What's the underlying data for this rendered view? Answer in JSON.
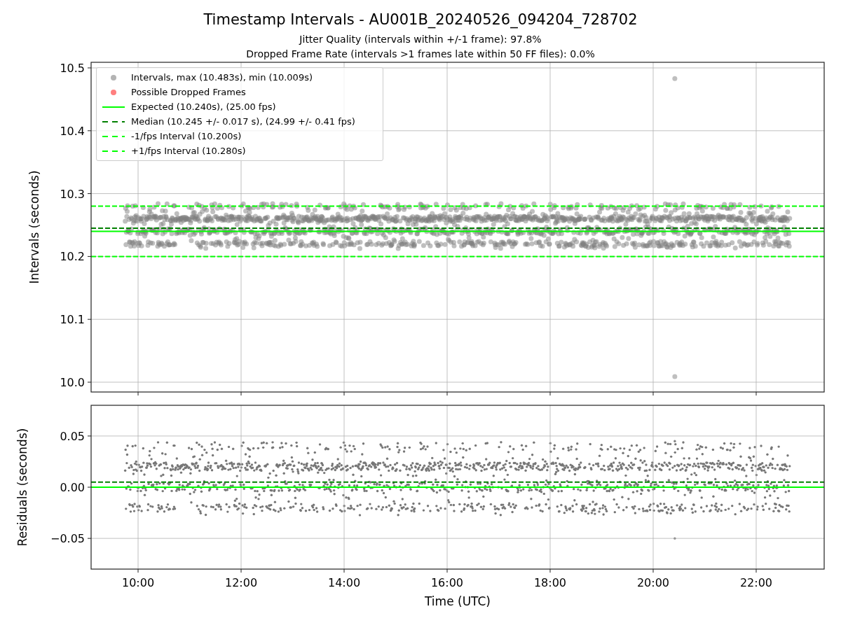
{
  "title": "Timestamp Intervals - AU001B_20240526_094204_728702",
  "subtitles": [
    "Jitter Quality (intervals within +/-1 frame): 97.8%",
    "Dropped Frame Rate (intervals >1 frames late within 50 FF files): 0.0%"
  ],
  "legend": [
    {
      "label": "Intervals, max (10.483s), min (10.009s)",
      "color": "#b3b3b3"
    },
    {
      "label": "Possible Dropped Frames",
      "color": "#ff7f7f"
    }
  ],
  "intervals_chart": {
    "chart_data": {
      "type": "line",
      "ylabel": "Intervals (seconds)",
      "grid": true,
      "x": [
        9.088,
        23.32
      ],
      "xlim": [
        9.088,
        23.32
      ],
      "ylim": [
        9.9844,
        10.5089
      ],
      "yticks": [
        {
          "value": 10.0,
          "label": "10.0"
        },
        {
          "value": 10.1,
          "label": "10.1"
        },
        {
          "value": 10.2,
          "label": "10.2"
        },
        {
          "value": 10.3,
          "label": "10.3"
        },
        {
          "value": 10.4,
          "label": "10.4"
        },
        {
          "value": 10.5,
          "label": "10.5"
        }
      ],
      "series": [
        {
          "name": "Expected (10.240s), (25.00 fps)",
          "color": "#00ff00",
          "line_style": "solid",
          "values": [
            10.24,
            10.24
          ]
        },
        {
          "name": "Median (10.245 +/- 0.017 s), (24.99 +/- 0.41 fps)",
          "color": "#008000",
          "line_style": "dashed",
          "values": [
            10.245,
            10.245
          ]
        },
        {
          "name": "-1/fps Interval (10.200s)",
          "color": "#00ff00",
          "line_style": "dashed",
          "values": [
            10.2,
            10.2
          ]
        },
        {
          "name": "+1/fps Interval (10.280s)",
          "color": "#00ff00",
          "line_style": "dashed",
          "values": [
            10.28,
            10.28
          ]
        }
      ]
    }
  },
  "residuals_chart": {
    "chart_data": {
      "type": "line",
      "xlabel": "Time (UTC)",
      "ylabel": "Residuals (seconds)",
      "grid": true,
      "x": [
        9.088,
        23.32
      ],
      "xlim": [
        9.088,
        23.32
      ],
      "ylim": [
        -0.08,
        0.08
      ],
      "xticks": [
        {
          "value": 10,
          "label": "10:00"
        },
        {
          "value": 12,
          "label": "12:00"
        },
        {
          "value": 14,
          "label": "14:00"
        },
        {
          "value": 16,
          "label": "16:00"
        },
        {
          "value": 18,
          "label": "18:00"
        },
        {
          "value": 20,
          "label": "20:00"
        },
        {
          "value": 22,
          "label": "22:00"
        }
      ],
      "yticks": [
        {
          "value": -0.05,
          "label": "−0.05"
        },
        {
          "value": 0,
          "label": "0.00"
        },
        {
          "value": 0.05,
          "label": "0.05"
        }
      ],
      "series": [
        {
          "color": "#008000",
          "line_style": "dashed",
          "values": [
            0.005,
            0.005
          ]
        },
        {
          "color": "#00ff00",
          "line_style": "solid",
          "values": [
            0,
            0
          ]
        }
      ]
    }
  }
}
